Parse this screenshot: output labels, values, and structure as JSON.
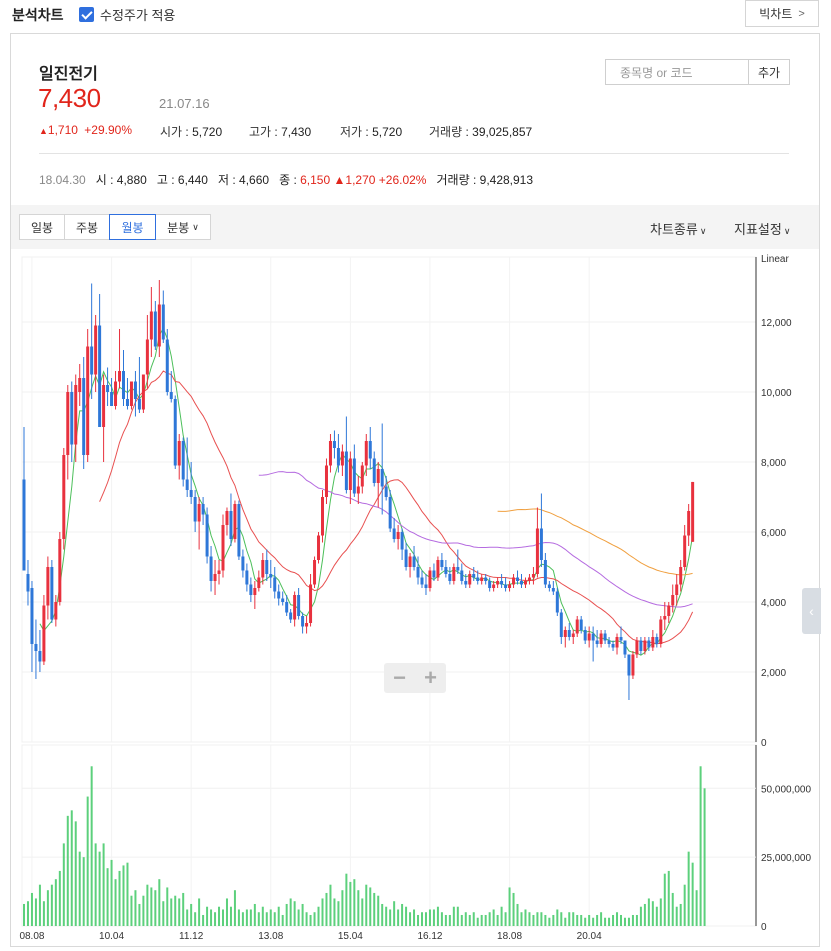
{
  "header": {
    "title": "분석차트",
    "adjusted_label": "수정주가 적용",
    "adjusted_checked": true,
    "bigchart_label": "빅차트"
  },
  "stock": {
    "name": "일진전기",
    "price": "7,430",
    "date": "21.07.16",
    "change": "1,710",
    "change_pct": "+29.90%",
    "open_label": "시가",
    "open": "5,720",
    "high_label": "고가",
    "high": "7,430",
    "low_label": "저가",
    "low": "5,720",
    "volume_label": "거래량",
    "volume": "39,025,857"
  },
  "search": {
    "placeholder": "종목명 or 코드",
    "add_label": "추가"
  },
  "history": {
    "date": "18.04.30",
    "open_label": "시",
    "open": "4,880",
    "high_label": "고",
    "high": "6,440",
    "low_label": "저",
    "low": "4,660",
    "close_label": "종",
    "close": "6,150",
    "change": "1,270",
    "change_pct": "+26.02%",
    "volume_label": "거래량",
    "volume": "9,428,913"
  },
  "period_tabs": [
    "일봉",
    "주봉",
    "월봉",
    "분봉"
  ],
  "selected_tab": "월봉",
  "menus": {
    "chart_type": "차트종류",
    "indicator": "지표설정"
  },
  "colors": {
    "up": "#e8313e",
    "down": "#2e77d8",
    "volume": "#5cd07c",
    "ma5": "#4cbf5a",
    "ma20": "#e85050",
    "ma60": "#b56be0",
    "ma120": "#f0a040"
  },
  "chart_data": {
    "type": "candlestick",
    "scale_label": "Linear",
    "price_ticks": [
      "0",
      "2,000",
      "4,000",
      "6,000",
      "8,000",
      "10,000",
      "12,000"
    ],
    "volume_ticks": [
      "0",
      "25,000,000",
      "50,000,000"
    ],
    "x_labels": [
      "08.08",
      "10.04",
      "11.12",
      "13.08",
      "15.04",
      "16.12",
      "18.08",
      "20.04"
    ],
    "price_range": [
      0,
      13800
    ],
    "volume_range": [
      0,
      65000000
    ],
    "months_start": "2008.06",
    "ohlc": [
      [
        7500,
        9000,
        6700,
        4900
      ],
      [
        4800,
        5200,
        3900,
        4300
      ],
      [
        4400,
        4600,
        2000,
        2800
      ],
      [
        2800,
        3500,
        1800,
        2600
      ],
      [
        2600,
        3200,
        2000,
        2300
      ],
      [
        2300,
        4200,
        2200,
        3900
      ],
      [
        3900,
        5300,
        3500,
        5000
      ],
      [
        5000,
        5200,
        3400,
        3500
      ],
      [
        3500,
        4200,
        3300,
        4000
      ],
      [
        4000,
        6000,
        3900,
        5800
      ],
      [
        5800,
        8400,
        5500,
        8200
      ],
      [
        8200,
        10200,
        7500,
        10000
      ],
      [
        10000,
        10300,
        8000,
        8500
      ],
      [
        8500,
        10500,
        8000,
        10200
      ],
      [
        10000,
        10800,
        9600,
        10400
      ],
      [
        10400,
        11000,
        7800,
        8200
      ],
      [
        8200,
        11800,
        8000,
        11300
      ],
      [
        11300,
        13100,
        9800,
        10500
      ],
      [
        10500,
        12200,
        10000,
        11900
      ],
      [
        11900,
        12800,
        9000,
        9000
      ],
      [
        9000,
        10500,
        8000,
        10200
      ],
      [
        10200,
        10700,
        9600,
        10000
      ],
      [
        10000,
        10400,
        9700,
        9600
      ],
      [
        9600,
        10600,
        9500,
        10300
      ],
      [
        10300,
        11800,
        10100,
        10600
      ],
      [
        10600,
        11200,
        9600,
        9800
      ],
      [
        9800,
        10400,
        9500,
        9600
      ],
      [
        9600,
        10300,
        9500,
        10300
      ],
      [
        10300,
        10600,
        9300,
        9800
      ],
      [
        9800,
        11000,
        9400,
        9500
      ],
      [
        9500,
        10500,
        9400,
        10500
      ],
      [
        10500,
        12200,
        10100,
        11500
      ],
      [
        11500,
        13000,
        11000,
        12300
      ],
      [
        12300,
        12600,
        11200,
        11300
      ],
      [
        11300,
        13200,
        11000,
        12500
      ],
      [
        12500,
        12900,
        11400,
        11500
      ],
      [
        11500,
        11800,
        9900,
        10000
      ],
      [
        10000,
        10600,
        9700,
        9800
      ],
      [
        9800,
        9900,
        7800,
        7900
      ],
      [
        7900,
        8800,
        7500,
        8600
      ],
      [
        8600,
        8700,
        7300,
        7500
      ],
      [
        7500,
        8700,
        7000,
        7200
      ],
      [
        7200,
        8000,
        6800,
        7000
      ],
      [
        7000,
        7200,
        6000,
        6300
      ],
      [
        6300,
        7000,
        5500,
        6800
      ],
      [
        6800,
        7000,
        6200,
        6500
      ],
      [
        6500,
        6700,
        5100,
        5300
      ],
      [
        5300,
        5600,
        4300,
        4600
      ],
      [
        4600,
        5200,
        4200,
        4800
      ],
      [
        4800,
        5200,
        4500,
        4900
      ],
      [
        4900,
        6500,
        4700,
        6200
      ],
      [
        6200,
        6700,
        5900,
        6600
      ],
      [
        6600,
        7100,
        5600,
        5800
      ],
      [
        5800,
        6900,
        5700,
        6800
      ],
      [
        6800,
        6900,
        5200,
        5300
      ],
      [
        5300,
        5500,
        4700,
        4900
      ],
      [
        4900,
        5100,
        4300,
        4500
      ],
      [
        4500,
        4700,
        4000,
        4200
      ],
      [
        4200,
        4600,
        3800,
        4400
      ],
      [
        4400,
        4900,
        4300,
        4700
      ],
      [
        4700,
        5400,
        4500,
        5200
      ],
      [
        5200,
        5500,
        4600,
        4800
      ],
      [
        4800,
        5200,
        4400,
        4700
      ],
      [
        4700,
        5000,
        4100,
        4300
      ],
      [
        4300,
        4500,
        3900,
        4100
      ],
      [
        4100,
        4300,
        3900,
        4000
      ],
      [
        4000,
        4200,
        3600,
        3700
      ],
      [
        3700,
        3800,
        3400,
        3500
      ],
      [
        3500,
        4300,
        3300,
        4200
      ],
      [
        4200,
        4400,
        3500,
        3600
      ],
      [
        3600,
        3700,
        3100,
        3300
      ],
      [
        3300,
        3600,
        3100,
        3400
      ],
      [
        3400,
        4800,
        3300,
        4500
      ],
      [
        4500,
        5300,
        4400,
        5200
      ],
      [
        5200,
        6000,
        5100,
        5900
      ],
      [
        5900,
        7200,
        5700,
        7000
      ],
      [
        7000,
        8100,
        6800,
        7900
      ],
      [
        7900,
        8800,
        7700,
        8600
      ],
      [
        8600,
        8900,
        8100,
        8400
      ],
      [
        8400,
        8800,
        7700,
        7900
      ],
      [
        7900,
        8500,
        7600,
        8300
      ],
      [
        8300,
        9300,
        7100,
        7200
      ],
      [
        7200,
        8300,
        6800,
        8100
      ],
      [
        8100,
        8500,
        7000,
        7100
      ],
      [
        7100,
        7600,
        6800,
        7300
      ],
      [
        7300,
        8000,
        7100,
        7900
      ],
      [
        7900,
        8800,
        7600,
        8600
      ],
      [
        8600,
        9000,
        7800,
        8100
      ],
      [
        8100,
        8300,
        7300,
        7400
      ],
      [
        7400,
        8000,
        6700,
        7800
      ],
      [
        7800,
        9100,
        6500,
        7300
      ],
      [
        7300,
        7600,
        6900,
        7000
      ],
      [
        7000,
        7200,
        6000,
        6100
      ],
      [
        6100,
        6400,
        5700,
        5800
      ],
      [
        5800,
        6200,
        5500,
        6000
      ],
      [
        6000,
        6100,
        5200,
        5500
      ],
      [
        5500,
        5700,
        4900,
        5000
      ],
      [
        5000,
        5400,
        4700,
        5300
      ],
      [
        5300,
        5600,
        4900,
        5000
      ],
      [
        5000,
        5300,
        4500,
        4700
      ],
      [
        4700,
        4900,
        4400,
        4500
      ],
      [
        4500,
        4800,
        4200,
        4400
      ],
      [
        4400,
        5000,
        4300,
        4900
      ],
      [
        4900,
        5100,
        4600,
        4700
      ],
      [
        4700,
        5300,
        4600,
        5200
      ],
      [
        5200,
        5400,
        4900,
        5000
      ],
      [
        5000,
        5200,
        4700,
        4800
      ],
      [
        4800,
        5000,
        4500,
        4600
      ],
      [
        4600,
        5100,
        4500,
        5000
      ],
      [
        5000,
        5500,
        4800,
        4900
      ],
      [
        4900,
        5100,
        4500,
        4600
      ],
      [
        4600,
        4800,
        4400,
        4500
      ],
      [
        4500,
        4900,
        4400,
        4800
      ],
      [
        4800,
        5000,
        4600,
        4700
      ],
      [
        4700,
        4900,
        4500,
        4600
      ],
      [
        4600,
        4800,
        4500,
        4700
      ],
      [
        4700,
        4800,
        4500,
        4600
      ],
      [
        4600,
        4700,
        4300,
        4400
      ],
      [
        4400,
        4600,
        4300,
        4500
      ],
      [
        4500,
        4700,
        4400,
        4600
      ],
      [
        4600,
        4800,
        4400,
        4500
      ],
      [
        4500,
        4700,
        4300,
        4400
      ],
      [
        4400,
        4600,
        4300,
        4500
      ],
      [
        4500,
        4800,
        4400,
        4700
      ],
      [
        4700,
        4900,
        4500,
        4600
      ],
      [
        4600,
        4800,
        4400,
        4500
      ],
      [
        4500,
        4700,
        4400,
        4600
      ],
      [
        4600,
        4800,
        4500,
        4700
      ],
      [
        4700,
        5000,
        4500,
        4800
      ],
      [
        4800,
        6700,
        4700,
        6100
      ],
      [
        6100,
        7100,
        5000,
        5200
      ],
      [
        5200,
        5400,
        4400,
        4500
      ],
      [
        4500,
        4600,
        4300,
        4400
      ],
      [
        4400,
        4600,
        4200,
        4300
      ],
      [
        4300,
        4400,
        3600,
        3700
      ],
      [
        3700,
        3800,
        2800,
        3000
      ],
      [
        3000,
        3300,
        2700,
        3200
      ],
      [
        3200,
        3400,
        2900,
        3000
      ],
      [
        3000,
        3200,
        2800,
        3100
      ],
      [
        3100,
        3600,
        3000,
        3500
      ],
      [
        3500,
        3600,
        3100,
        3200
      ],
      [
        3200,
        3300,
        2800,
        2900
      ],
      [
        2900,
        3300,
        2700,
        3100
      ],
      [
        3100,
        3300,
        2300,
        2900
      ],
      [
        2900,
        3200,
        2700,
        2800
      ],
      [
        2800,
        3200,
        2700,
        3100
      ],
      [
        3100,
        3200,
        2800,
        2900
      ],
      [
        2900,
        3000,
        2700,
        2800
      ],
      [
        2800,
        2900,
        2600,
        2700
      ],
      [
        2700,
        3100,
        2500,
        3000
      ],
      [
        3000,
        3300,
        2800,
        2900
      ],
      [
        2900,
        2900,
        2400,
        2500
      ],
      [
        2500,
        2500,
        1200,
        1900
      ],
      [
        1900,
        2600,
        1800,
        2500
      ],
      [
        2500,
        3000,
        2400,
        2900
      ],
      [
        2900,
        3000,
        2500,
        2600
      ],
      [
        2600,
        3000,
        2500,
        2900
      ],
      [
        2900,
        3000,
        2600,
        2700
      ],
      [
        2700,
        3200,
        2600,
        3000
      ],
      [
        3000,
        3100,
        2700,
        2800
      ],
      [
        2800,
        3600,
        2700,
        3500
      ],
      [
        3500,
        4000,
        3200,
        3600
      ],
      [
        3600,
        4000,
        3400,
        3900
      ],
      [
        3900,
        4500,
        3700,
        4200
      ],
      [
        4200,
        4800,
        3900,
        4500
      ],
      [
        4500,
        5200,
        4300,
        5000
      ],
      [
        5000,
        6200,
        4900,
        5900
      ],
      [
        5900,
        6800,
        5600,
        6600
      ],
      [
        5720,
        7430,
        5720,
        7430
      ]
    ],
    "volume": [
      8,
      9,
      12,
      10,
      15,
      9,
      13,
      15,
      17,
      20,
      30,
      40,
      42,
      38,
      27,
      25,
      47,
      58,
      30,
      27,
      30,
      21,
      24,
      17,
      20,
      22,
      23,
      11,
      13,
      8,
      11,
      15,
      14,
      13,
      17,
      9,
      14,
      10,
      11,
      10,
      12,
      6,
      8,
      5,
      10,
      4,
      7,
      6,
      5,
      7,
      6,
      10,
      7,
      13,
      6,
      5,
      6,
      6,
      8,
      5,
      7,
      5,
      6,
      5,
      7,
      4,
      8,
      10,
      9,
      6,
      8,
      5,
      4,
      5,
      7,
      10,
      12,
      15,
      10,
      9,
      13,
      19,
      16,
      17,
      13,
      10,
      15,
      14,
      12,
      11,
      8,
      7,
      6,
      9,
      6,
      8,
      7,
      5,
      6,
      4,
      5,
      5,
      6,
      6,
      7,
      5,
      4,
      4,
      7,
      7,
      4,
      5,
      4,
      5,
      3,
      4,
      4,
      5,
      6,
      4,
      7,
      5,
      14,
      12,
      8,
      5,
      6,
      5,
      4,
      5,
      5,
      4,
      3,
      4,
      6,
      5,
      3,
      5,
      5,
      4,
      4,
      3,
      4,
      3,
      4,
      5,
      3,
      3,
      4,
      5,
      4,
      3,
      3,
      4,
      4,
      7,
      8,
      10,
      9,
      7,
      10,
      19,
      20,
      12,
      7,
      8,
      15,
      27,
      23,
      13,
      58,
      50
    ]
  }
}
